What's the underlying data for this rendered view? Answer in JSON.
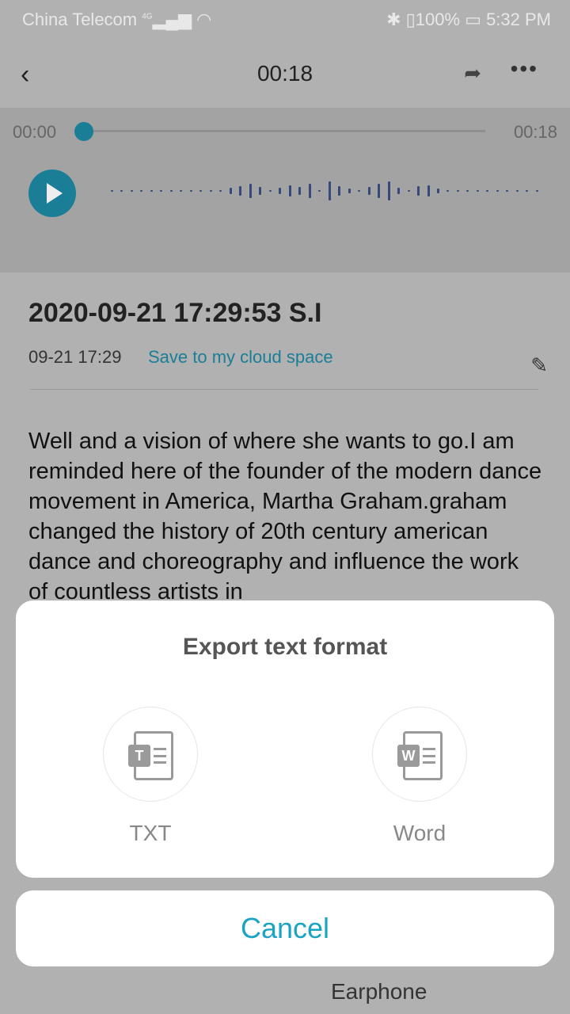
{
  "status_bar": {
    "carrier": "China Telecom",
    "network": "4G",
    "battery": "100%",
    "time": "5:32 PM"
  },
  "header": {
    "title": "00:18"
  },
  "player": {
    "current_time": "00:00",
    "total_time": "00:18",
    "progress": 0
  },
  "recording": {
    "title": "2020-09-21 17:29:53 S.I",
    "date": "09-21 17:29",
    "save_link": "Save to my cloud space",
    "transcript": "Well and a vision of where she wants to go.I am reminded here of the founder of the modern dance movement in America, Martha Graham.graham changed the history of 20th century american dance and choreography and influence the work of countless artists in"
  },
  "bottom_bar": {
    "right_label": "Earphone"
  },
  "export_sheet": {
    "title": "Export text format",
    "options": [
      {
        "label": "TXT",
        "badge": "T"
      },
      {
        "label": "Word",
        "badge": "W"
      }
    ],
    "cancel": "Cancel"
  },
  "colors": {
    "accent": "#1a7e97",
    "cancel": "#1aa3c2"
  }
}
